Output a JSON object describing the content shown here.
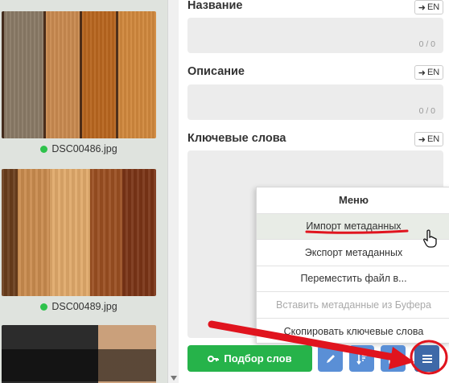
{
  "gallery": {
    "items": [
      {
        "filename": "DSC00486.jpg"
      },
      {
        "filename": "DSC00489.jpg"
      }
    ]
  },
  "fields": {
    "title": {
      "label": "Название",
      "lang": "EN",
      "counter": "0 / 0"
    },
    "description": {
      "label": "Описание",
      "lang": "EN",
      "counter": "0 / 0"
    },
    "keywords": {
      "label": "Ключевые слова",
      "lang": "EN"
    }
  },
  "menu": {
    "header": "Меню",
    "items": [
      {
        "label": "Импорт метаданных",
        "state": "hover"
      },
      {
        "label": "Экспорт метаданных",
        "state": "normal"
      },
      {
        "label": "Переместить файл в...",
        "state": "normal"
      },
      {
        "label": "Вставить метаданные из Буфера",
        "state": "disabled"
      },
      {
        "label": "Скопировать ключевые слова",
        "state": "normal"
      }
    ]
  },
  "toolbar": {
    "word_pick_label": "Подбор слов"
  },
  "colors": {
    "green": "#26b34a",
    "blue": "#5a8fd6",
    "annotation_red": "#e0141e"
  }
}
